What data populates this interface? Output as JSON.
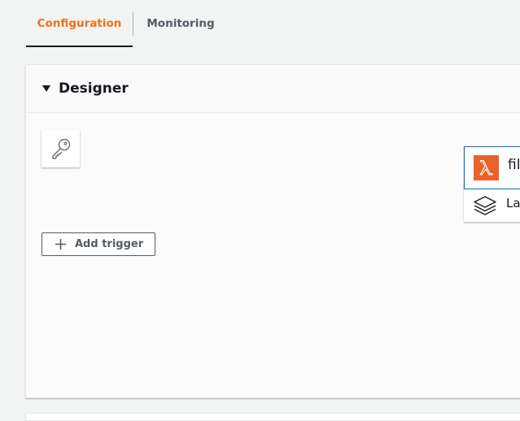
{
  "tabs": {
    "configuration": "Configuration",
    "monitoring": "Monitoring",
    "active_color": "#ec7211",
    "inactive_color": "#545b64"
  },
  "designer": {
    "title": "Designer",
    "add_trigger_label": "Add trigger",
    "function_name": "fil",
    "layers_label": "La",
    "icons": {
      "collapse": "caret-down-icon",
      "permissions": "key-icon",
      "add": "plus-icon",
      "function": "lambda-icon",
      "layers": "layers-icon"
    }
  }
}
